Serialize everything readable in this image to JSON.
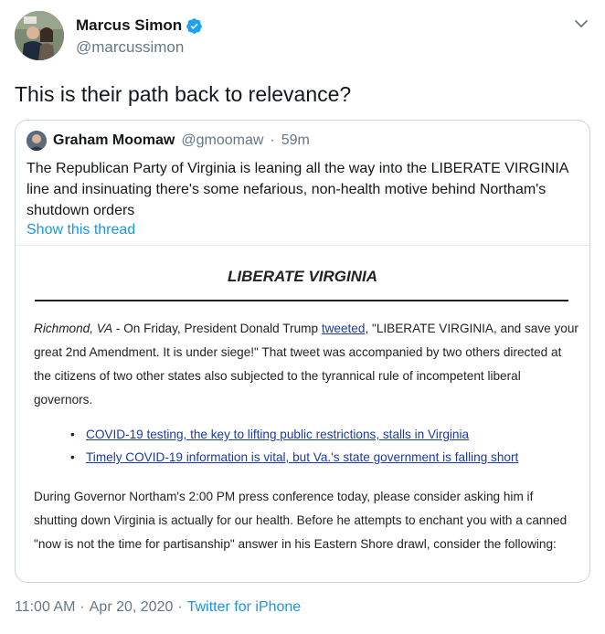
{
  "author": {
    "display_name": "Marcus Simon",
    "handle": "@marcussimon",
    "verified_icon": "verified-badge-icon"
  },
  "tweet": {
    "text": "This is their path back to relevance?"
  },
  "quoted": {
    "display_name": "Graham Moomaw",
    "handle": "@gmoomaw",
    "separator": "·",
    "time": "59m",
    "text": "The Republican Party of Virginia is leaning all the way into the LIBERATE VIRGINIA line and insinuating there's some nefarious, non-health motive behind Northam's shutdown orders",
    "show_thread": "Show this thread",
    "attachment": {
      "title": "LIBERATE VIRGINIA",
      "p1_dateline": "Richmond, VA",
      "p1_before_link": " - On Friday, President Donald Trump ",
      "p1_link": "tweeted",
      "p1_after_link": ", \"LIBERATE VIRGINIA, and save your great 2nd Amendment. It is under siege!\" That tweet was accompanied by two others directed at the citizens of two other states also subjected to the tyrannical rule of incompetent liberal governors.",
      "links": [
        "COVID-19 testing, the key to lifting public restrictions, stalls in Virginia",
        "Timely COVID-19 information is vital, but Va.'s state government is falling short"
      ],
      "p2": "During Governor Northam's 2:00 PM press conference today, please consider asking him if shutting down Virginia is actually for our health. Before he attempts to enchant you with a canned \"now is not the time for partisanship\" answer in his Eastern Shore drawl, consider the following:"
    }
  },
  "footer": {
    "time": "11:00 AM",
    "sep1": "·",
    "date": "Apr 20, 2020",
    "sep2": "·",
    "source": "Twitter for iPhone"
  },
  "colors": {
    "link_blue": "#1b95e0",
    "secondary_text": "#657786",
    "doc_link": "#1a3aa8"
  }
}
